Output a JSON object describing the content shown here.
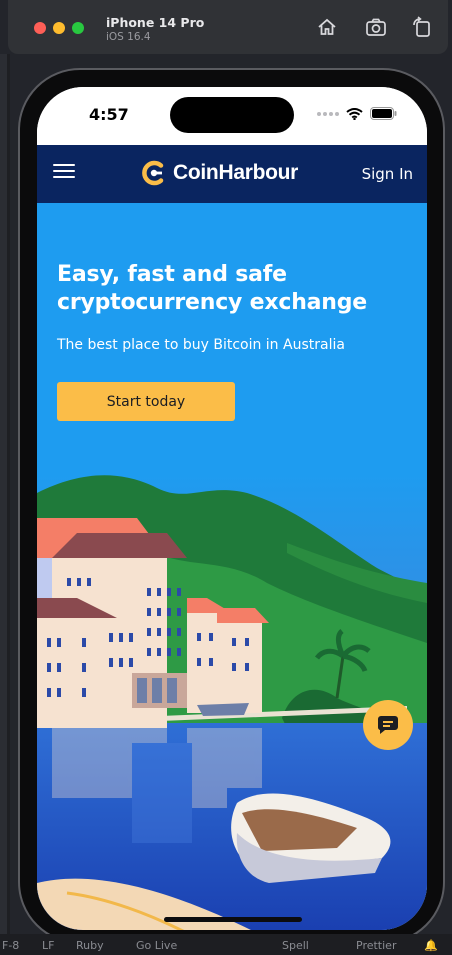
{
  "simulator": {
    "device_name": "iPhone 14 Pro",
    "os_version": "iOS 16.4"
  },
  "editor_status": {
    "encoding": "F-8",
    "line_ending": "LF",
    "language": "Ruby",
    "live_server": "Go Live",
    "spell": "Spell",
    "formatter": "Prettier"
  },
  "phone_status": {
    "time": "4:57"
  },
  "navbar": {
    "brand": "CoinHarbour",
    "sign_in": "Sign In"
  },
  "hero": {
    "title": "Easy, fast and safe cryptocurrency exchange",
    "subtitle": "The best place to buy Bitcoin in Australia",
    "cta": "Start today"
  },
  "colors": {
    "nav_bg": "#0a2560",
    "hero_bg": "#1e9cf0",
    "accent": "#fbbd48"
  }
}
